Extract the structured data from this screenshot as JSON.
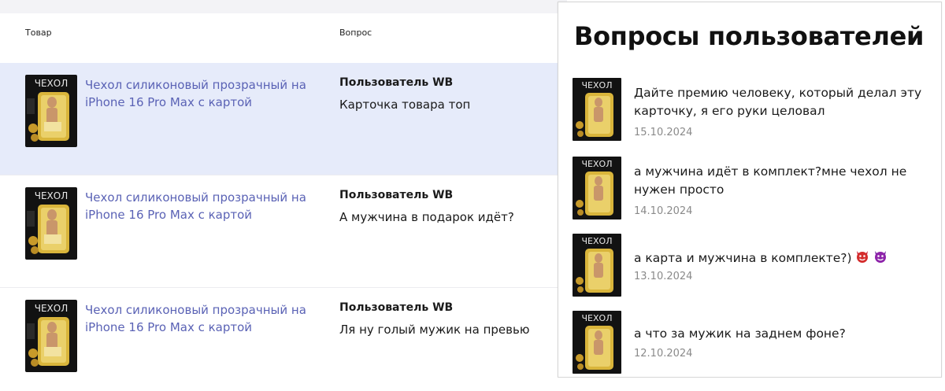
{
  "table": {
    "col_product": "Товар",
    "col_question": "Вопрос",
    "rows": [
      {
        "thumb_label": "ЧЕХОЛ",
        "product": "Чехол силиконовый прозрачный на iPhone 16 Pro Max с картой",
        "user": "Пользователь WB",
        "question": "Карточка товара топ",
        "selected": true
      },
      {
        "thumb_label": "ЧЕХОЛ",
        "product": "Чехол силиконовый прозрачный на iPhone 16 Pro Max с картой",
        "user": "Пользователь WB",
        "question": "А мужчина в подарок идёт?",
        "selected": false
      },
      {
        "thumb_label": "ЧЕХОЛ",
        "product": "Чехол силиконовый прозрачный на iPhone 16 Pro Max с картой",
        "user": "Пользователь WB",
        "question": "Ля ну голый мужик на превью",
        "selected": false
      }
    ]
  },
  "qa": {
    "title": "Вопросы пользователей",
    "items": [
      {
        "thumb_label": "ЧЕХОЛ",
        "text": "Дайте премию человеку, который делал эту карточку, я его руки целовал",
        "date": "15.10.2024"
      },
      {
        "thumb_label": "ЧЕХОЛ",
        "text": "а мужчина идёт в комплект?мне чехол не нужен просто",
        "date": "14.10.2024"
      },
      {
        "thumb_label": "ЧЕХОЛ",
        "text": "а карта и мужчина в комплекте?)",
        "date": "13.10.2024",
        "emoji": [
          "devil-face-icon",
          "devil-face-icon"
        ]
      },
      {
        "thumb_label": "ЧЕХОЛ",
        "text": "а что за мужик на заднем фоне?",
        "date": "12.10.2024"
      }
    ]
  },
  "colors": {
    "link": "#5a62b5",
    "selected_row": "#e6ebfa",
    "date": "#8a8a8a"
  }
}
